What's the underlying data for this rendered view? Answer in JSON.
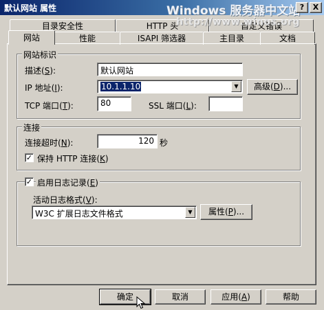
{
  "window": {
    "title": "默认网站 属性",
    "watermark_line1": "Windows 服务器中文站",
    "watermark_line2": "http://www.winos.org",
    "help_btn": "?",
    "close_btn": "X"
  },
  "tabs": {
    "back": [
      "目录安全性",
      "HTTP 头",
      "自定义错误"
    ],
    "front": [
      "网站",
      "性能",
      "ISAPI 筛选器",
      "主目录",
      "文档"
    ],
    "active": "网站"
  },
  "identity": {
    "group_label": "网站标识",
    "desc_label": "描述",
    "desc_key": "S",
    "desc_value": "默认网站",
    "ip_label": "IP 地址",
    "ip_key": "I",
    "ip_value": "10.1.1.10",
    "advanced_btn": "高级",
    "advanced_key": "D",
    "tcp_label": "TCP 端口",
    "tcp_key": "T",
    "tcp_value": "80",
    "ssl_label": "SSL 端口",
    "ssl_key": "L",
    "ssl_value": ""
  },
  "connection": {
    "group_label": "连接",
    "timeout_label": "连接超时",
    "timeout_key": "N",
    "timeout_value": "120",
    "seconds_unit": "秒",
    "keepalive_label": "保持 HTTP 连接",
    "keepalive_key": "K",
    "keepalive_checked": true
  },
  "logging": {
    "enable_label": "启用日志记录",
    "enable_key": "E",
    "enable_checked": true,
    "format_label": "活动日志格式",
    "format_key": "V",
    "format_value": "W3C 扩展日志文件格式",
    "props_btn": "属性",
    "props_key": "P"
  },
  "footer": {
    "ok": "确定",
    "cancel": "取消",
    "apply": "应用",
    "apply_key": "A",
    "help": "帮助"
  },
  "ui_symbols": {
    "check": "✓",
    "dropdown_arrow": "▼",
    "ellipsis": "...",
    "colon": ":",
    "paren_open": "(",
    "paren_close": ")"
  },
  "colors": {
    "face": "#d4d0c8",
    "title_start": "#0a246a",
    "title_end": "#a6caf0",
    "selection": "#0a246a"
  }
}
